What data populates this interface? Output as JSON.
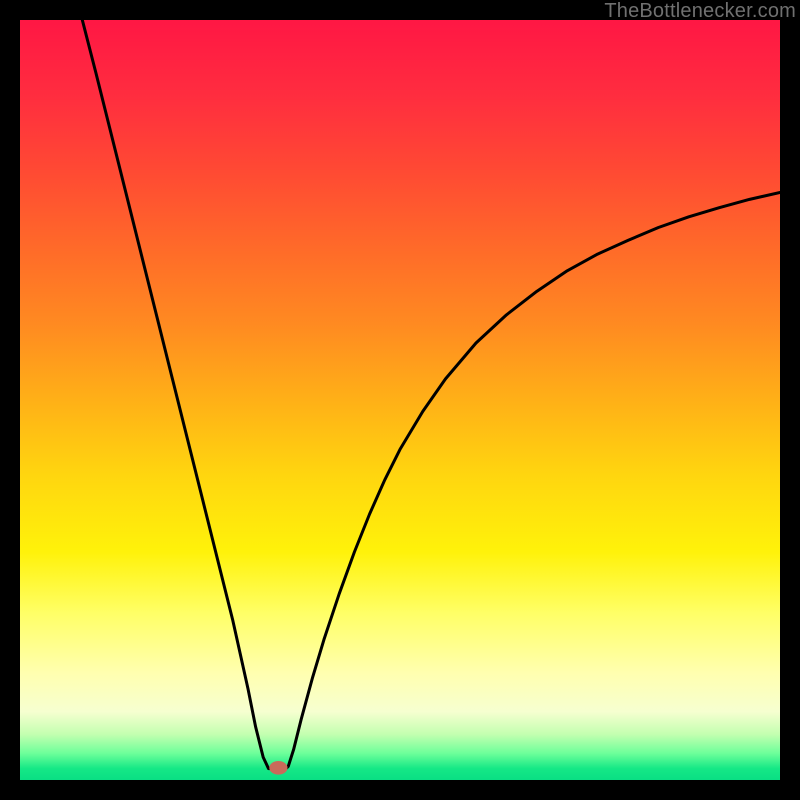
{
  "watermark": "TheBottlenecker.com",
  "chart_data": {
    "type": "line",
    "title": "",
    "xlabel": "",
    "ylabel": "",
    "xlim": [
      0,
      100
    ],
    "ylim": [
      0,
      100
    ],
    "background_gradient": {
      "stops": [
        {
          "offset": 0.0,
          "color": "#ff1744"
        },
        {
          "offset": 0.1,
          "color": "#ff2d3f"
        },
        {
          "offset": 0.2,
          "color": "#ff4a33"
        },
        {
          "offset": 0.3,
          "color": "#ff6a29"
        },
        {
          "offset": 0.4,
          "color": "#ff8a21"
        },
        {
          "offset": 0.5,
          "color": "#ffb017"
        },
        {
          "offset": 0.6,
          "color": "#ffd60f"
        },
        {
          "offset": 0.7,
          "color": "#fff20a"
        },
        {
          "offset": 0.78,
          "color": "#ffff66"
        },
        {
          "offset": 0.86,
          "color": "#ffffb0"
        },
        {
          "offset": 0.91,
          "color": "#f6ffd0"
        },
        {
          "offset": 0.94,
          "color": "#c3ffb0"
        },
        {
          "offset": 0.965,
          "color": "#6dff9a"
        },
        {
          "offset": 0.985,
          "color": "#15e886"
        },
        {
          "offset": 1.0,
          "color": "#0adf84"
        }
      ]
    },
    "curve": {
      "vertex_x": 33.0,
      "points_left": [
        {
          "x": 8.2,
          "y": 100.0
        },
        {
          "x": 10.0,
          "y": 93.0
        },
        {
          "x": 12.0,
          "y": 85.0
        },
        {
          "x": 14.0,
          "y": 77.0
        },
        {
          "x": 16.0,
          "y": 69.0
        },
        {
          "x": 18.0,
          "y": 61.0
        },
        {
          "x": 20.0,
          "y": 53.0
        },
        {
          "x": 22.0,
          "y": 45.0
        },
        {
          "x": 24.0,
          "y": 37.0
        },
        {
          "x": 26.0,
          "y": 29.0
        },
        {
          "x": 28.0,
          "y": 21.0
        },
        {
          "x": 30.0,
          "y": 12.0
        },
        {
          "x": 31.0,
          "y": 7.0
        },
        {
          "x": 32.0,
          "y": 3.0
        },
        {
          "x": 32.7,
          "y": 1.5
        }
      ],
      "flat_bottom": [
        {
          "x": 32.7,
          "y": 1.5
        },
        {
          "x": 35.0,
          "y": 1.5
        }
      ],
      "points_right": [
        {
          "x": 35.3,
          "y": 1.8
        },
        {
          "x": 36.0,
          "y": 4.0
        },
        {
          "x": 37.0,
          "y": 8.0
        },
        {
          "x": 38.5,
          "y": 13.5
        },
        {
          "x": 40.0,
          "y": 18.5
        },
        {
          "x": 42.0,
          "y": 24.5
        },
        {
          "x": 44.0,
          "y": 30.0
        },
        {
          "x": 46.0,
          "y": 35.0
        },
        {
          "x": 48.0,
          "y": 39.5
        },
        {
          "x": 50.0,
          "y": 43.5
        },
        {
          "x": 53.0,
          "y": 48.5
        },
        {
          "x": 56.0,
          "y": 52.8
        },
        {
          "x": 60.0,
          "y": 57.5
        },
        {
          "x": 64.0,
          "y": 61.2
        },
        {
          "x": 68.0,
          "y": 64.3
        },
        {
          "x": 72.0,
          "y": 67.0
        },
        {
          "x": 76.0,
          "y": 69.2
        },
        {
          "x": 80.0,
          "y": 71.0
        },
        {
          "x": 84.0,
          "y": 72.7
        },
        {
          "x": 88.0,
          "y": 74.1
        },
        {
          "x": 92.0,
          "y": 75.3
        },
        {
          "x": 96.0,
          "y": 76.4
        },
        {
          "x": 100.0,
          "y": 77.3
        }
      ]
    },
    "marker": {
      "x": 34.0,
      "y": 1.6,
      "rx": 1.2,
      "ry": 0.9,
      "color": "#c96a5a"
    }
  }
}
